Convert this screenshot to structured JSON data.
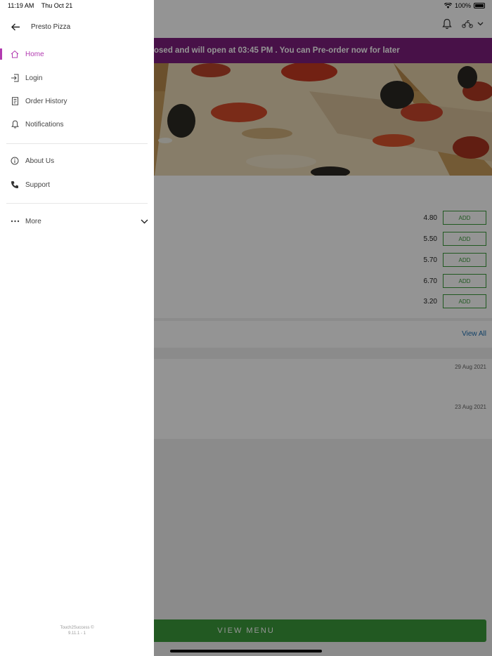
{
  "status_bar": {
    "time": "11:19 AM",
    "date": "Thu Oct 21",
    "battery": "100%"
  },
  "banner": {
    "text": "osed and will open at 03:45 PM . You can Pre-order now for later",
    "color": "#7c1e7c"
  },
  "menu_items": [
    {
      "price": "4.80",
      "button": "ADD"
    },
    {
      "price": "5.50",
      "button": "ADD"
    },
    {
      "price": "5.70",
      "button": "ADD"
    },
    {
      "price": "6.70",
      "button": "ADD"
    },
    {
      "price": "3.20",
      "button": "ADD"
    }
  ],
  "reviews": {
    "view_all": "View All",
    "dates": [
      "29 Aug 2021",
      "23 Aug 2021"
    ]
  },
  "view_menu_button": "VIEW MENU",
  "drawer": {
    "title": "Presto Pizza",
    "items": [
      {
        "label": "Home",
        "icon": "home-icon",
        "active": true
      },
      {
        "label": "Login",
        "icon": "login-icon"
      },
      {
        "label": "Order History",
        "icon": "receipt-icon"
      },
      {
        "label": "Notifications",
        "icon": "bell-icon"
      },
      {
        "label": "About Us",
        "icon": "info-icon"
      },
      {
        "label": "Support",
        "icon": "phone-icon"
      },
      {
        "label": "More",
        "icon": "ellipsis-icon"
      }
    ],
    "footer_line1": "Touch2Success ©",
    "footer_line2": "9.11.1 - 1"
  },
  "colors": {
    "accent": "#b23bb0",
    "add_green": "#3a9a3a",
    "view_all_blue": "#1e6fb0"
  }
}
